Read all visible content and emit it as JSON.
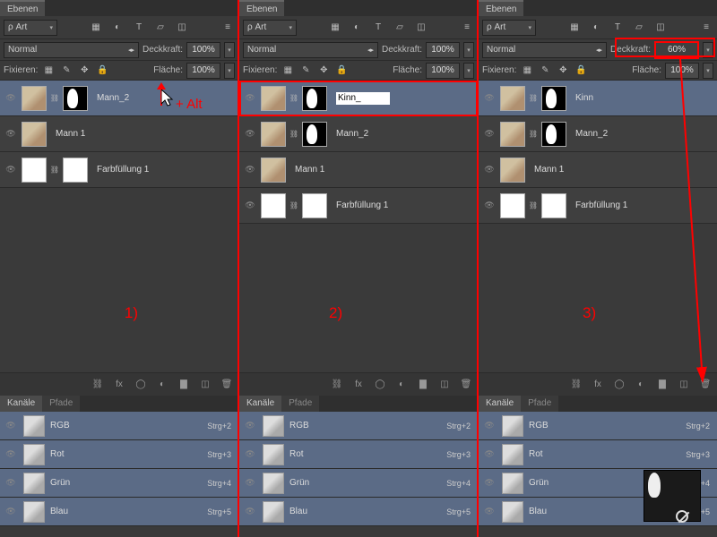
{
  "ui": {
    "layers_label": "Ebenen",
    "channels_label": "Kanäle",
    "paths_label": "Pfade",
    "search_label": "Art",
    "blend_mode": "Normal",
    "opacity_label": "Deckkraft:",
    "fill_label": "Fläche:",
    "lock_label": "Fixieren:",
    "pct100": "100%",
    "pct60": "60%"
  },
  "panels": [
    {
      "step": "1)",
      "layers": [
        {
          "name": "Mann_2",
          "selected": true
        },
        {
          "name": "Mann 1"
        },
        {
          "name": "Farbfüllung 1",
          "fill": true
        }
      ]
    },
    {
      "step": "2)",
      "layerEditValue": "Kinn_",
      "layers": [
        {
          "name": "Kinn",
          "selected": true,
          "editing": true
        },
        {
          "name": "Mann_2"
        },
        {
          "name": "Mann 1"
        },
        {
          "name": "Farbfüllung 1",
          "fill": true
        }
      ]
    },
    {
      "step": "3)",
      "opacity": "60%",
      "layers": [
        {
          "name": "Kinn",
          "selected": true
        },
        {
          "name": "Mann_2"
        },
        {
          "name": "Mann 1"
        },
        {
          "name": "Farbfüllung 1",
          "fill": true
        }
      ]
    }
  ],
  "channels": [
    {
      "name": "RGB",
      "key": "Strg+2"
    },
    {
      "name": "Rot",
      "key": "Strg+3"
    },
    {
      "name": "Grün",
      "key": "Strg+4"
    },
    {
      "name": "Blau",
      "key": "Strg+5"
    }
  ],
  "annot": {
    "alt": "+ Alt"
  }
}
